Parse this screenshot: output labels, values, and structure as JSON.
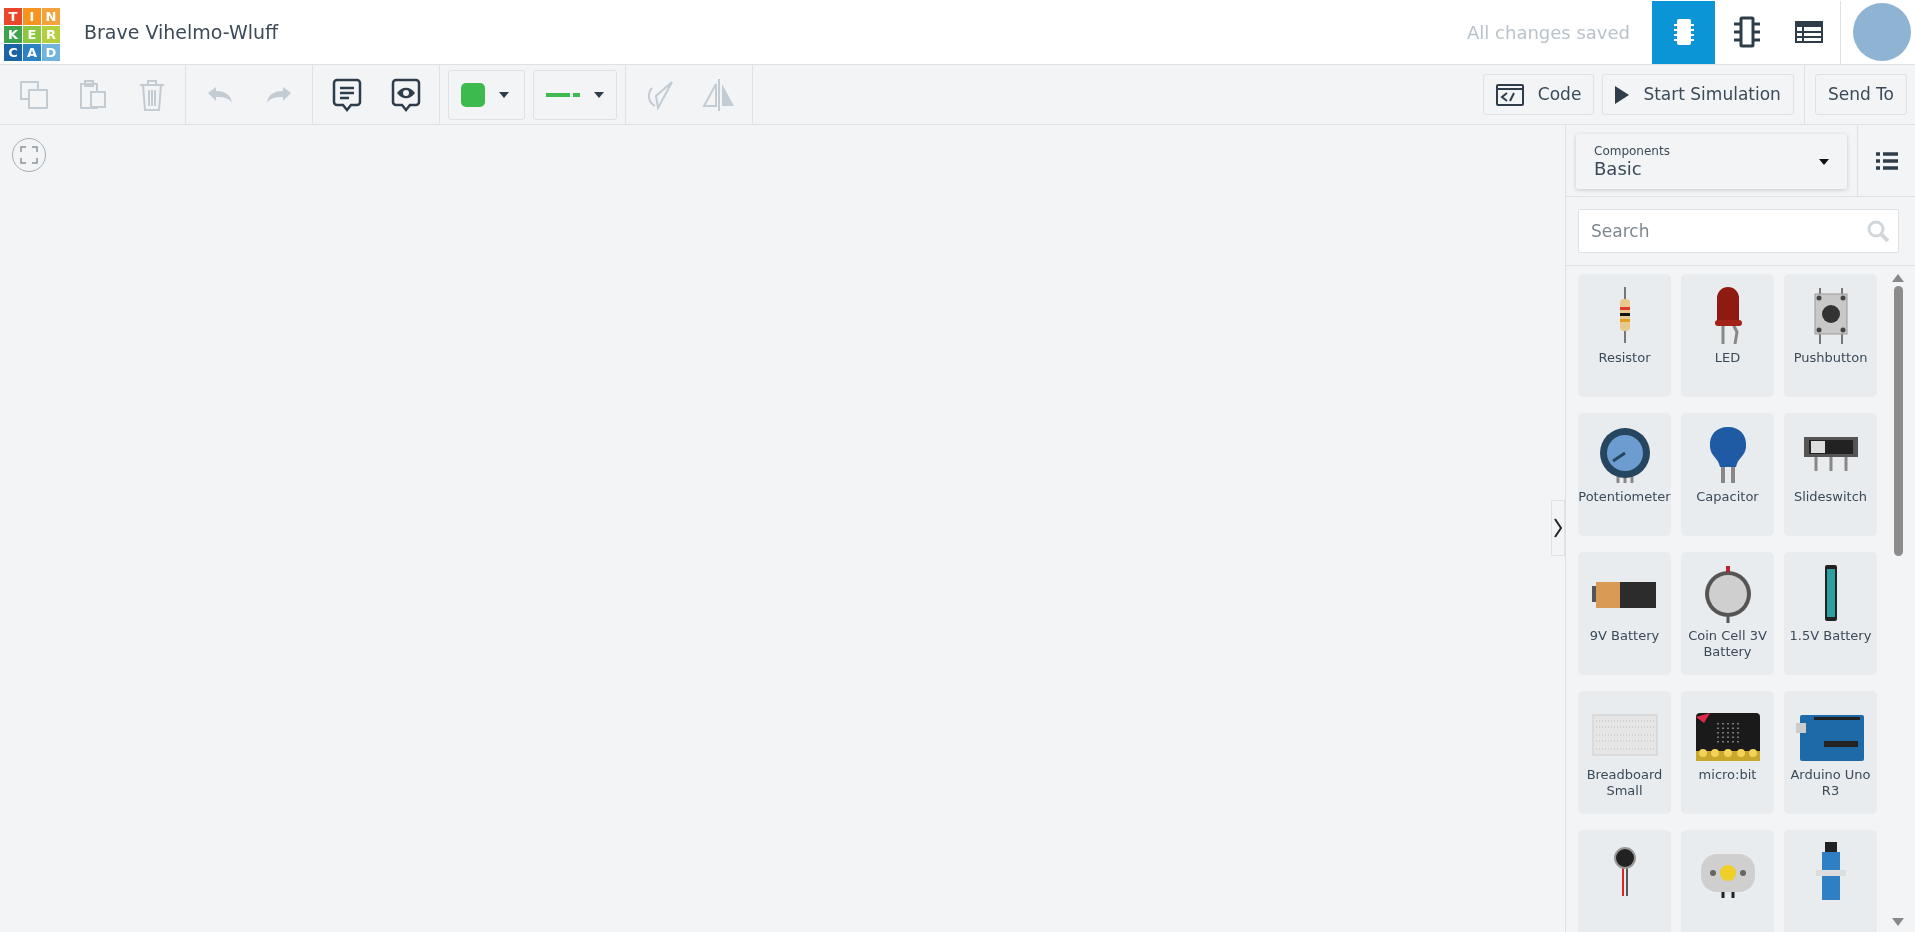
{
  "header": {
    "logo_letters": [
      "T",
      "I",
      "N",
      "K",
      "E",
      "R",
      "C",
      "A",
      "D"
    ],
    "title": "Brave Vihelmo-Wluff",
    "save_status": "All changes saved",
    "views": [
      {
        "kind": "circuit",
        "selected": true
      },
      {
        "kind": "schematic",
        "selected": false
      },
      {
        "kind": "table",
        "selected": false
      }
    ]
  },
  "toolbar": {
    "tools": [
      {
        "kind": "copy",
        "disabled": true
      },
      {
        "kind": "paste",
        "disabled": true
      },
      {
        "kind": "delete",
        "disabled": true
      },
      {
        "kind": "undo",
        "disabled": true
      },
      {
        "kind": "redo",
        "disabled": true
      },
      {
        "kind": "notes",
        "disabled": false
      },
      {
        "kind": "notes-visibility",
        "disabled": false
      },
      {
        "kind": "fill-color",
        "disabled": false
      },
      {
        "kind": "wire-style",
        "disabled": false
      },
      {
        "kind": "rotate",
        "disabled": true
      },
      {
        "kind": "flip",
        "disabled": true
      }
    ],
    "buttons": [
      {
        "kind": "code",
        "label": "Code"
      },
      {
        "kind": "start",
        "label": "Start Simulation"
      },
      {
        "kind": "send",
        "label": "Send To"
      }
    ]
  },
  "panel": {
    "category_label": "Components",
    "category": "Basic",
    "search": {
      "placeholder": "Search"
    },
    "components": [
      {
        "kind": "resistor",
        "label": "Resistor"
      },
      {
        "kind": "led",
        "label": "LED"
      },
      {
        "kind": "pushbutton",
        "label": "Pushbutton"
      },
      {
        "kind": "potentiometer",
        "label": "Potentiometer"
      },
      {
        "kind": "capacitor",
        "label": "Capacitor"
      },
      {
        "kind": "slideswitch",
        "label": "Slideswitch"
      },
      {
        "kind": "battery9v",
        "label": "9V Battery"
      },
      {
        "kind": "coincell",
        "label": "Coin Cell 3V Battery"
      },
      {
        "kind": "battery15",
        "label": "1.5V Battery"
      },
      {
        "kind": "breadboard",
        "label": "Breadboard Small"
      },
      {
        "kind": "microbit",
        "label": "micro:bit"
      },
      {
        "kind": "arduino",
        "label": "Arduino Uno R3"
      },
      {
        "kind": "vibration"
      },
      {
        "kind": "motor"
      },
      {
        "kind": "servo"
      }
    ]
  }
}
